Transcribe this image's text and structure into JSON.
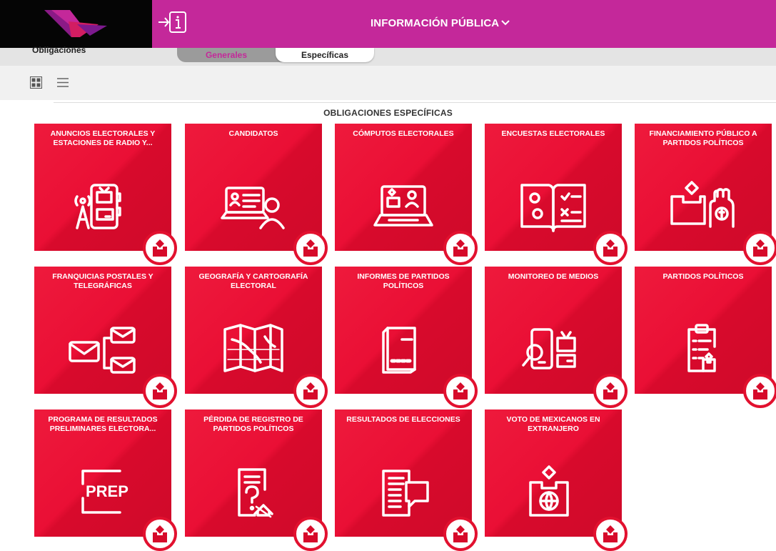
{
  "header": {
    "title": "INFORMACIÓN PÚBLICA",
    "title_icon": "chevron-down-icon",
    "logo": "logo",
    "info_icon": "info-login-icon",
    "brand_color": "#c4289a"
  },
  "subnav": {
    "label": "Obligaciones",
    "tabs": [
      {
        "label": "Generales",
        "active": false
      },
      {
        "label": "Específicas",
        "active": true
      }
    ]
  },
  "view_toggle": {
    "grid_icon": "grid-view-icon",
    "list_icon": "list-view-icon"
  },
  "section_title": "OBLIGACIONES ESPECÍFICAS",
  "tiles": [
    {
      "label": "ANUNCIOS ELECTORALES Y ESTACIONES DE RADIO Y...",
      "icon": "radio-tv-icon"
    },
    {
      "label": "CANDIDATOS",
      "icon": "candidate-laptop-icon"
    },
    {
      "label": "CÓMPUTOS ELECTORALES",
      "icon": "laptop-vote-icon"
    },
    {
      "label": "ENCUESTAS ELECTORALES",
      "icon": "survey-book-icon"
    },
    {
      "label": "FINANCIAMIENTO PÚBLICO A PARTIDOS POLÍTICOS",
      "icon": "ballot-money-icon"
    },
    {
      "label": "FRANQUICIAS POSTALES Y TELEGRÁFICAS",
      "icon": "mail-icon"
    },
    {
      "label": "GEOGRAFÍA Y CARTOGRAFÍA ELECTORAL",
      "icon": "map-icon"
    },
    {
      "label": "INFORMES DE PARTIDOS POLÍTICOS",
      "icon": "report-book-icon"
    },
    {
      "label": "MONITOREO DE MEDIOS",
      "icon": "media-monitor-icon"
    },
    {
      "label": "PARTIDOS POLÍTICOS",
      "icon": "clipboard-icon"
    },
    {
      "label": "PROGRAMA DE RESULTADOS PRELIMINARES ELECTORA...",
      "icon": "prep-icon",
      "icon_text": "PREP"
    },
    {
      "label": "PÉRDIDA DE REGISTRO DE PARTIDOS POLÍTICOS",
      "icon": "document-question-icon"
    },
    {
      "label": "RESULTADOS DE ELECCIONES",
      "icon": "results-chat-icon"
    },
    {
      "label": "VOTO DE MEXICANOS EN EXTRANJERO",
      "icon": "ballot-globe-icon"
    }
  ],
  "tile_badge_icon": "ballot-box-icon",
  "tile_color": "#ea0f35"
}
